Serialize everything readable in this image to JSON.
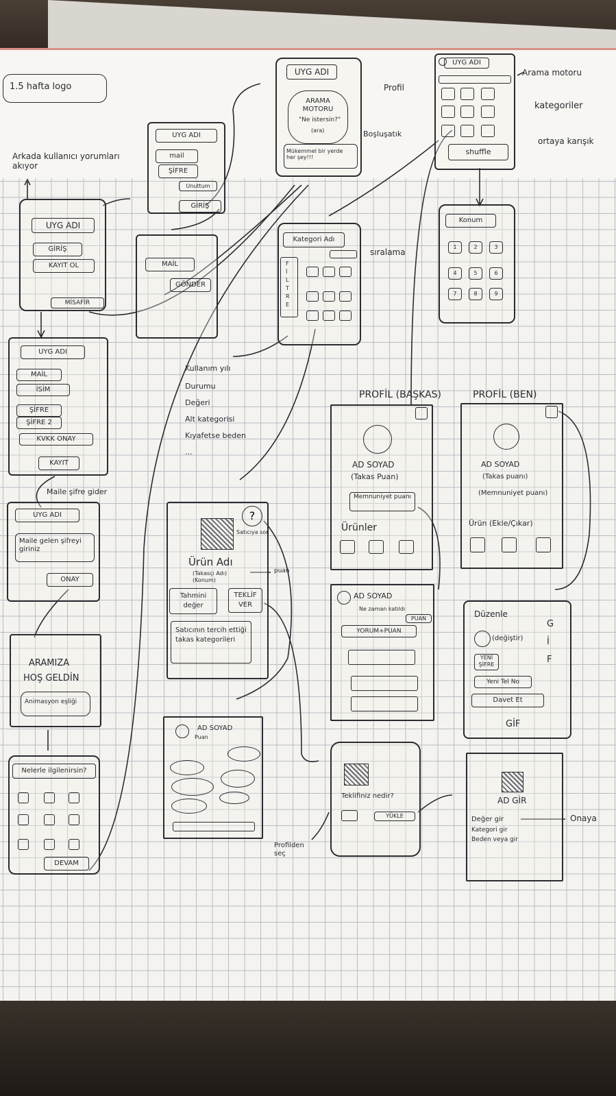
{
  "title": "1.5 hafta logo",
  "notes": {
    "arkada": "Arkada kullanıcı yorumları akıyor",
    "arama_motoru": "Arama motoru",
    "kategoriler": "kategoriler",
    "profil": "Profil",
    "bosluk": "Boşluşatık",
    "ortaya": "ortaya karışık",
    "siralama": "sıralama",
    "maile": "Maile şifre gider",
    "puan": "puan",
    "profilden": "Profilden seç",
    "onaya": "Onaya"
  },
  "screens": {
    "splash": {
      "app": "UYG ADI",
      "giris": "GİRİŞ",
      "kayit": "KAYIT OL",
      "misafir": "MİSAFİR"
    },
    "login": {
      "app": "UYG ADI",
      "mail": "mail",
      "sifre": "ŞİFRE",
      "unuttum": "Unuttum",
      "giris": "GİRİŞ"
    },
    "forgot": {
      "mail": "MAİL",
      "gonder": "GÖNDER"
    },
    "search": {
      "app": "UYG ADI",
      "search_title": "ARAMA MOTORU",
      "search_hint": "\"Ne istersin?\"",
      "search_sub": "(ara)",
      "tagline": "Mükemmel bir yerde her şey!!!"
    },
    "home": {
      "app": "UYG ADI",
      "shuffle": "shuffle"
    },
    "category": {
      "title": "Kategori Adı",
      "filtre": "F İ L T R E"
    },
    "location": {
      "konum": "Konum",
      "cells": [
        "1",
        "2",
        "3",
        "4",
        "5",
        "6",
        "7",
        "8",
        "9"
      ]
    },
    "register": {
      "app": "UYG ADI",
      "mail": "MAİL",
      "ad": "İSİM",
      "sifre": "ŞİFRE",
      "sifre2": "ŞİFRE 2",
      "kvkk": "KVKK ONAY",
      "kayit": "KAYIT"
    },
    "reset": {
      "app": "UYG ADI",
      "msg": "Maile gelen şifreyi giriniz",
      "onay": "ONAY"
    },
    "welcome": {
      "line1": "ARAMIZA",
      "line2": "HOŞ GELDİN",
      "anim": "Animasyon eşliği"
    },
    "interests": {
      "title": "Nelerle ilgilenirsin?",
      "devam": "DEVAM"
    },
    "filter_list": [
      "Kullanım yılı",
      "Durumu",
      "Değeri",
      "Alt kategorisi",
      "Kıyafetse beden",
      "..."
    ],
    "product": {
      "help": "?",
      "help_note": "Satıcıya sor",
      "name": "Ürün Adı",
      "seller": "(Takasçı Adı)",
      "konum": "(Konum)",
      "estimate": "Tahmini değer",
      "offer": "TEKLİF VER",
      "pref": "Satıcının tercih ettiği takas kategorileri"
    },
    "profile_other": {
      "header": "PROFİL (BAŞKAS)",
      "name": "AD SOYAD",
      "points": "(Takas Puan)",
      "memnuniyet": "Memnuniyet puanı",
      "urunler": "Ürünler"
    },
    "profile_me": {
      "header": "PROFİL (BEN)",
      "name": "AD SOYAD",
      "points": "(Takas puanı)",
      "memnuniyet": "(Memnuniyet puanı)",
      "urun": "Ürün (Ekle/Çıkar)"
    },
    "rate": {
      "name": "AD SOYAD",
      "since": "Ne zaman katıldı",
      "puan": "PUAN",
      "yorum": "YORUM+PUAN"
    },
    "settings": {
      "duzenle": "Düzenle",
      "degistir": "(değiştir)",
      "yeni_sifre": "YENİ ŞİFRE",
      "yeni_tel": "Yeni Tel No",
      "davet": "Davet Et",
      "gif_side": "G İ F",
      "gif": "GİF"
    },
    "comments": {
      "name": "AD SOYAD",
      "puan": "Puan"
    },
    "offer_screen": {
      "q": "Teklifiniz nedir?",
      "yukle": "YÜKLE"
    },
    "add": {
      "title": "AD GİR",
      "deger": "Değer gir",
      "kategori": "Kategori gir",
      "beden": "Beden veya gir"
    }
  }
}
